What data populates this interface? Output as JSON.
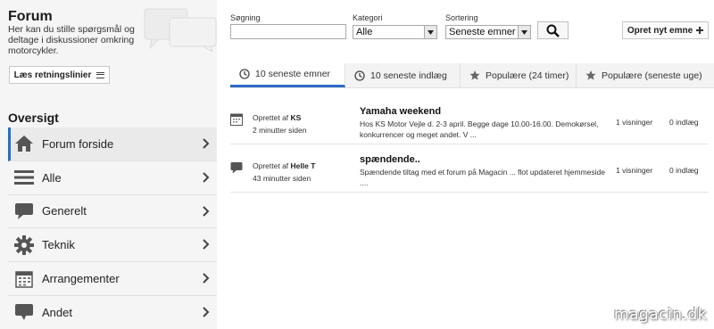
{
  "forum": {
    "title": "Forum",
    "description": "Her kan du stille spørgsmål og deltage i diskussioner omkring motorcykler.",
    "guidelines_label": "Læs retningslinier"
  },
  "overview": {
    "title": "Oversigt",
    "items": [
      {
        "label": "Forum forside",
        "icon": "home-icon",
        "active": true
      },
      {
        "label": "Alle",
        "icon": "list-icon",
        "active": false
      },
      {
        "label": "Generelt",
        "icon": "speech-bubble-icon",
        "active": false
      },
      {
        "label": "Teknik",
        "icon": "gear-icon",
        "active": false
      },
      {
        "label": "Arrangementer",
        "icon": "calendar-icon",
        "active": false
      },
      {
        "label": "Andet",
        "icon": "chat-icon",
        "active": false
      }
    ]
  },
  "filters": {
    "search_label": "Søgning",
    "search_value": "",
    "category_label": "Kategori",
    "category_value": "Alle",
    "sort_label": "Sortering",
    "sort_value": "Seneste emner",
    "new_topic_label": "Opret nyt emne"
  },
  "tabs": [
    {
      "label": "10 seneste emner",
      "icon": "clock-icon",
      "active": true
    },
    {
      "label": "10 seneste indlæg",
      "icon": "clock-icon",
      "active": false
    },
    {
      "label": "Populære (24 timer)",
      "icon": "star-icon",
      "active": false
    },
    {
      "label": "Populære (seneste uge)",
      "icon": "star-icon",
      "active": false
    }
  ],
  "topics": [
    {
      "created_prefix": "Oprettet af",
      "author": "KS",
      "time_ago": "2 minutter siden",
      "title": "Yamaha weekend",
      "excerpt": "Hos KS Motor Vejle d. 2-3 april. Begge dage 10.00-16.00. Demokørsel, konkurrencer og meget andet. V ...",
      "views": "1 visninger",
      "posts": "0 indlæg",
      "icon": "calendar-icon"
    },
    {
      "created_prefix": "Oprettet af",
      "author": "Helle T",
      "time_ago": "43 minutter siden",
      "title": "spændende..",
      "excerpt": "Spændende tiltag med et forum på Magacin ... flot updateret hjemmeside ....",
      "views": "1 visninger",
      "posts": "0 indlæg",
      "icon": "speech-bubble-icon"
    }
  ],
  "watermark": "magacin.dk",
  "colors": {
    "accent": "#2b6cc4",
    "sidebar_bg": "#f5f5f5"
  }
}
